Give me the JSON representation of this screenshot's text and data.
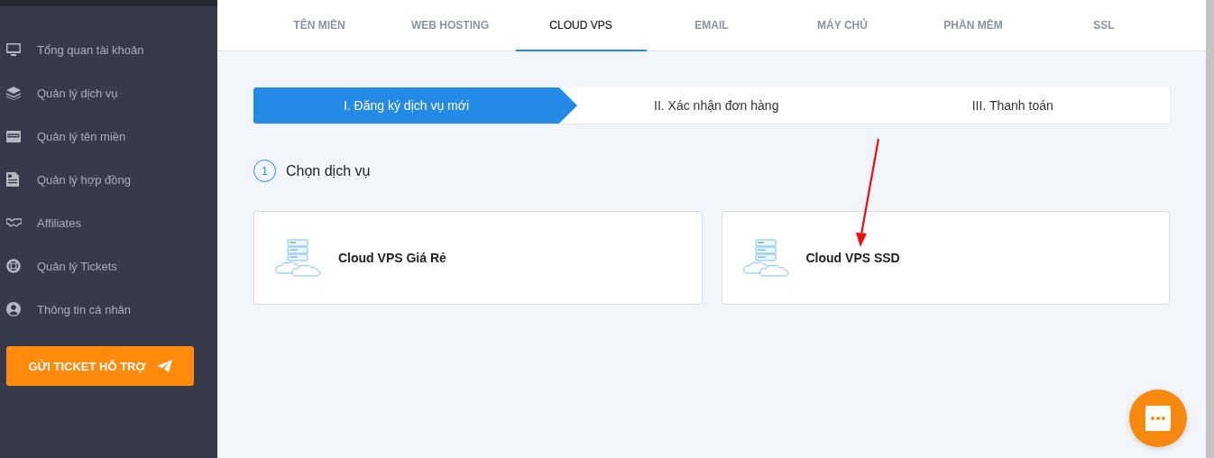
{
  "sidebar": {
    "items": [
      {
        "label": "Tổng quan tài khoản"
      },
      {
        "label": "Quản lý dịch vụ"
      },
      {
        "label": "Quản lý tên miền"
      },
      {
        "label": "Quản lý hợp đồng"
      },
      {
        "label": "Affiliates"
      },
      {
        "label": "Quản lý Tickets"
      },
      {
        "label": "Thông tin cá nhân"
      }
    ],
    "button": {
      "label": "GỬI TICKET HỖ TRỢ"
    }
  },
  "tabs": [
    {
      "label": "TÊN MIỀN",
      "selected": false
    },
    {
      "label": "WEB HOSTING",
      "selected": false
    },
    {
      "label": "CLOUD VPS",
      "selected": true
    },
    {
      "label": "EMAIL",
      "selected": false
    },
    {
      "label": "MÁY CHỦ",
      "selected": false
    },
    {
      "label": "PHẦN MỀM",
      "selected": false
    },
    {
      "label": "SSL",
      "selected": false
    }
  ],
  "steps": [
    {
      "label": "I. Đăng ký dịch vụ mới",
      "selected": true
    },
    {
      "label": "II. Xác nhận đơn hàng",
      "selected": false
    },
    {
      "label": "III. Thanh toán",
      "selected": false
    }
  ],
  "section": {
    "number": "1",
    "title": "Chọn dịch vụ"
  },
  "services": [
    {
      "label": "Cloud VPS Giá Rẻ"
    },
    {
      "label": "Cloud VPS SSD"
    }
  ]
}
